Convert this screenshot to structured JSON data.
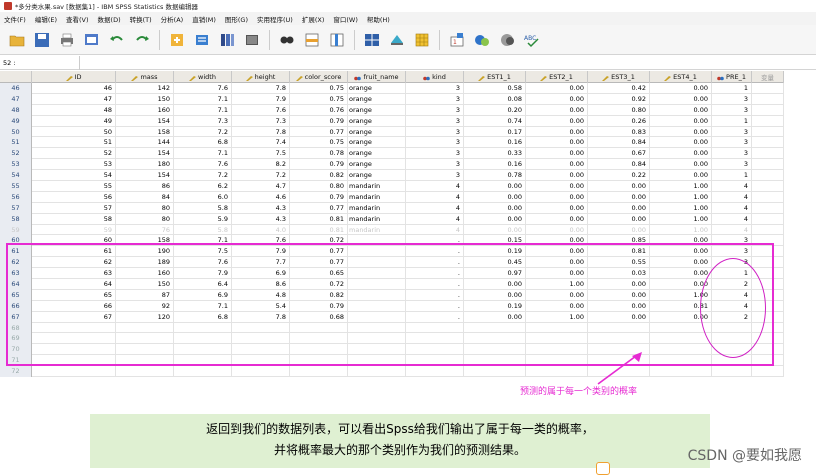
{
  "window": {
    "title": "*多分类水果.sav [数据集1] - IBM SPSS Statistics 数据编辑器"
  },
  "menu": [
    "文件(F)",
    "编辑(E)",
    "查看(V)",
    "数据(D)",
    "转换(T)",
    "分析(A)",
    "直销(M)",
    "图形(G)",
    "实用程序(U)",
    "扩展(X)",
    "窗口(W)",
    "帮助(H)"
  ],
  "toolbar": {
    "icons": [
      "open-folder-icon",
      "save-icon",
      "print-icon",
      "dialog-recall-icon",
      "undo-icon",
      "redo-icon",
      "goto-case-icon",
      "goto-variable-icon",
      "variables-icon",
      "run-descriptives-icon",
      "find-icon",
      "insert-cases-icon",
      "insert-variable-icon",
      "split-file-icon",
      "weight-cases-icon",
      "select-cases-icon",
      "value-labels-icon",
      "use-sets-icon",
      "show-all-variables-icon",
      "spelling-icon"
    ],
    "spelling_label": "ABC"
  },
  "cell_ref": "52 :",
  "grid": {
    "columns": [
      "ID",
      "mass",
      "width",
      "height",
      "color_score",
      "fruit_name",
      "kind",
      "EST1_1",
      "EST2_1",
      "EST3_1",
      "EST4_1",
      "PRE_1",
      "变量"
    ],
    "rows": [
      {
        "n": "46",
        "cells": [
          "46",
          "142",
          "7.6",
          "7.8",
          "0.75",
          "orange",
          "3",
          "0.58",
          "0.00",
          "0.42",
          "0.00",
          "1"
        ]
      },
      {
        "n": "47",
        "cells": [
          "47",
          "150",
          "7.1",
          "7.9",
          "0.75",
          "orange",
          "3",
          "0.08",
          "0.00",
          "0.92",
          "0.00",
          "3"
        ]
      },
      {
        "n": "48",
        "cells": [
          "48",
          "160",
          "7.1",
          "7.6",
          "0.76",
          "orange",
          "3",
          "0.20",
          "0.00",
          "0.80",
          "0.00",
          "3"
        ]
      },
      {
        "n": "49",
        "cells": [
          "49",
          "154",
          "7.3",
          "7.3",
          "0.79",
          "orange",
          "3",
          "0.74",
          "0.00",
          "0.26",
          "0.00",
          "1"
        ]
      },
      {
        "n": "50",
        "cells": [
          "50",
          "158",
          "7.2",
          "7.8",
          "0.77",
          "orange",
          "3",
          "0.17",
          "0.00",
          "0.83",
          "0.00",
          "3"
        ]
      },
      {
        "n": "51",
        "cells": [
          "51",
          "144",
          "6.8",
          "7.4",
          "0.75",
          "orange",
          "3",
          "0.16",
          "0.00",
          "0.84",
          "0.00",
          "3"
        ]
      },
      {
        "n": "52",
        "cells": [
          "52",
          "154",
          "7.1",
          "7.5",
          "0.78",
          "orange",
          "3",
          "0.33",
          "0.00",
          "0.67",
          "0.00",
          "3"
        ]
      },
      {
        "n": "53",
        "cells": [
          "53",
          "180",
          "7.6",
          "8.2",
          "0.79",
          "orange",
          "3",
          "0.16",
          "0.00",
          "0.84",
          "0.00",
          "3"
        ]
      },
      {
        "n": "54",
        "cells": [
          "54",
          "154",
          "7.2",
          "7.2",
          "0.82",
          "orange",
          "3",
          "0.78",
          "0.00",
          "0.22",
          "0.00",
          "1"
        ]
      },
      {
        "n": "55",
        "cells": [
          "55",
          "86",
          "6.2",
          "4.7",
          "0.80",
          "mandarin",
          "4",
          "0.00",
          "0.00",
          "0.00",
          "1.00",
          "4"
        ]
      },
      {
        "n": "56",
        "cells": [
          "56",
          "84",
          "6.0",
          "4.6",
          "0.79",
          "mandarin",
          "4",
          "0.00",
          "0.00",
          "0.00",
          "1.00",
          "4"
        ]
      },
      {
        "n": "57",
        "cells": [
          "57",
          "80",
          "5.8",
          "4.3",
          "0.77",
          "mandarin",
          "4",
          "0.00",
          "0.00",
          "0.00",
          "1.00",
          "4"
        ]
      },
      {
        "n": "58",
        "cells": [
          "58",
          "80",
          "5.9",
          "4.3",
          "0.81",
          "mandarin",
          "4",
          "0.00",
          "0.00",
          "0.00",
          "1.00",
          "4"
        ]
      },
      {
        "n": "59",
        "faded": true,
        "cells": [
          "59",
          "76",
          "5.8",
          "4.0",
          "0.81",
          "mandarin",
          "4",
          "0.00",
          "0.00",
          "0.00",
          "1.00",
          "4"
        ]
      },
      {
        "n": "60",
        "cells": [
          "60",
          "158",
          "7.1",
          "7.6",
          "0.72",
          "",
          ".",
          "0.15",
          "0.00",
          "0.85",
          "0.00",
          "3"
        ]
      },
      {
        "n": "61",
        "cells": [
          "61",
          "190",
          "7.5",
          "7.9",
          "0.77",
          "",
          ".",
          "0.19",
          "0.00",
          "0.81",
          "0.00",
          "3"
        ]
      },
      {
        "n": "62",
        "cells": [
          "62",
          "189",
          "7.6",
          "7.7",
          "0.77",
          "",
          ".",
          "0.45",
          "0.00",
          "0.55",
          "0.00",
          "3"
        ]
      },
      {
        "n": "63",
        "cells": [
          "63",
          "160",
          "7.9",
          "6.9",
          "0.65",
          "",
          ".",
          "0.97",
          "0.00",
          "0.03",
          "0.00",
          "1"
        ]
      },
      {
        "n": "64",
        "cells": [
          "64",
          "150",
          "6.4",
          "8.6",
          "0.72",
          "",
          ".",
          "0.00",
          "1.00",
          "0.00",
          "0.00",
          "2"
        ]
      },
      {
        "n": "65",
        "cells": [
          "65",
          "87",
          "6.9",
          "4.8",
          "0.82",
          "",
          ".",
          "0.00",
          "0.00",
          "0.00",
          "1.00",
          "4"
        ]
      },
      {
        "n": "66",
        "cells": [
          "66",
          "92",
          "7.1",
          "5.4",
          "0.79",
          "",
          ".",
          "0.19",
          "0.00",
          "0.00",
          "0.81",
          "4"
        ]
      },
      {
        "n": "67",
        "cells": [
          "67",
          "120",
          "6.8",
          "7.8",
          "0.68",
          "",
          ".",
          "0.00",
          "1.00",
          "0.00",
          "0.00",
          "2"
        ]
      },
      {
        "n": "68",
        "empty": true,
        "cells": []
      },
      {
        "n": "69",
        "empty": true,
        "cells": []
      },
      {
        "n": "70",
        "empty": true,
        "cells": []
      },
      {
        "n": "71",
        "empty": true,
        "cells": []
      },
      {
        "n": "72",
        "empty": true,
        "cells": []
      }
    ]
  },
  "annotation": {
    "text": "预测的属于每一个类别的概率",
    "color": "#e62bd2"
  },
  "caption": {
    "line1": "返回到我们的数据列表，可以看出Spss给我们输出了属于每一类的概率，",
    "line2": "并将概率最大的那个类别作为我们的预测结果。",
    "background": "#dff0d2"
  },
  "watermark": "CSDN @要如我愿"
}
